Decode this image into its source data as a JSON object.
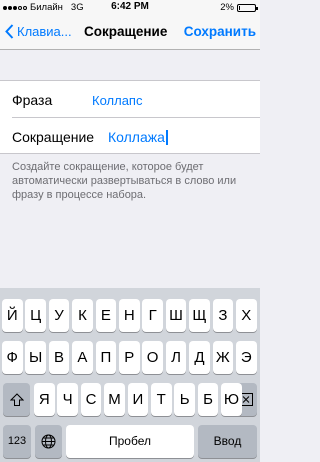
{
  "status": {
    "carrier": "Билайн",
    "network": "3G",
    "time": "6:42 PM",
    "battery": "2%",
    "battery_level": 0.02
  },
  "nav": {
    "back_label": "Клавиа...",
    "title": "Сокращение",
    "save_label": "Сохранить"
  },
  "form": {
    "phrase_label": "Фраза",
    "phrase_value": "Коллапс",
    "shortcut_label": "Сокращение",
    "shortcut_value": "Коллажа"
  },
  "footer_text": "Создайте сокращение, которое будет автоматически развертываться в слово или фразу в процессе набора.",
  "keyboard": {
    "row1": [
      "Й",
      "Ц",
      "У",
      "К",
      "Е",
      "Н",
      "Г",
      "Ш",
      "Щ",
      "З",
      "Х"
    ],
    "row2": [
      "Ф",
      "Ы",
      "В",
      "А",
      "П",
      "Р",
      "О",
      "Л",
      "Д",
      "Ж",
      "Э"
    ],
    "row3": [
      "Я",
      "Ч",
      "С",
      "М",
      "И",
      "Т",
      "Ь",
      "Б",
      "Ю"
    ],
    "numbers_label": "123",
    "space_label": "Пробел",
    "return_label": "Ввод",
    "shift_icon": "shift-icon",
    "delete_icon": "delete-icon",
    "globe_icon": "globe-icon"
  }
}
